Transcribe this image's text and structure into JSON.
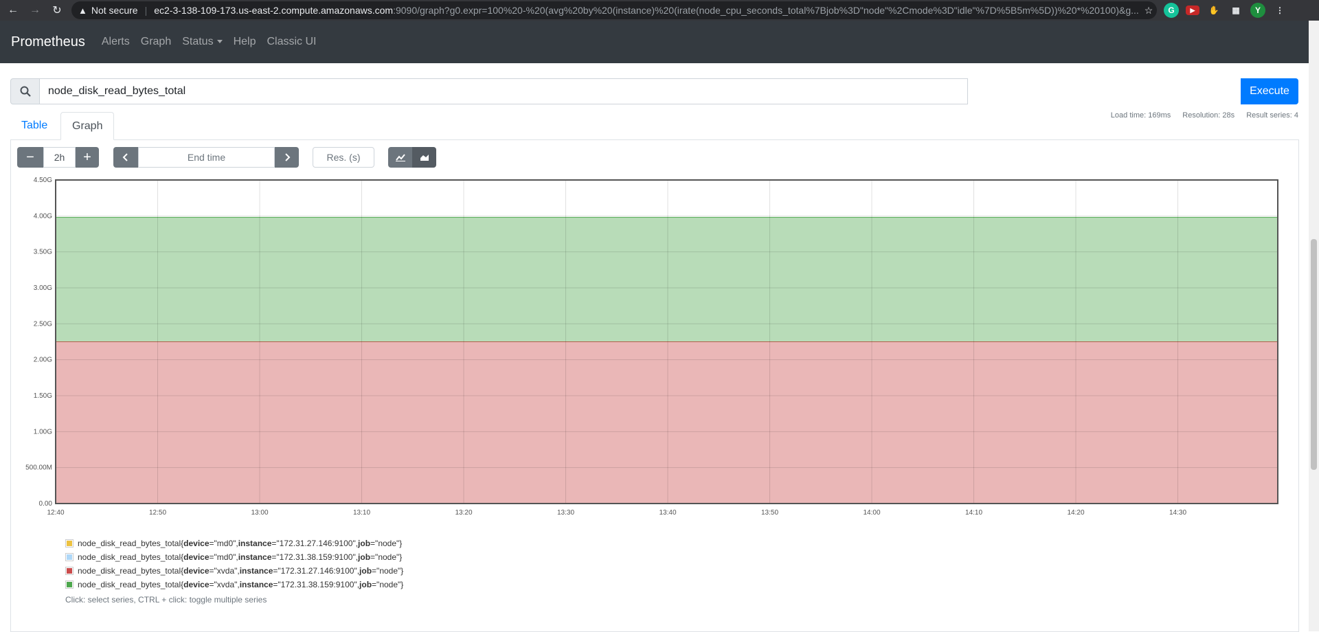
{
  "browser": {
    "security_warning": "Not secure",
    "url_host": "ec2-3-138-109-173.us-east-2.compute.amazonaws.com",
    "url_path": ":9090/graph?g0.expr=100%20-%20(avg%20by%20(instance)%20(irate(node_cpu_seconds_total%7Bjob%3D\"node\"%2Cmode%3D\"idle\"%7D%5B5m%5D))%20*%20100)&g...",
    "profile_initial": "Y"
  },
  "navbar": {
    "brand": "Prometheus",
    "links": [
      "Alerts",
      "Graph",
      "Status",
      "Help",
      "Classic UI"
    ]
  },
  "query": {
    "expression": "node_disk_read_bytes_total",
    "execute_label": "Execute"
  },
  "stats": {
    "load_time": "Load time: 169ms",
    "resolution": "Resolution: 28s",
    "result_series": "Result series: 4"
  },
  "tabs": {
    "table": "Table",
    "graph": "Graph"
  },
  "controls": {
    "range": "2h",
    "end_time_placeholder": "End time",
    "resolution_placeholder": "Res. (s)"
  },
  "chart_data": {
    "type": "area",
    "stacked": true,
    "x": [
      "12:40",
      "12:50",
      "13:00",
      "13:10",
      "13:20",
      "13:30",
      "13:40",
      "13:50",
      "14:00",
      "14:10",
      "14:20",
      "14:30"
    ],
    "y_ticks": [
      "0.00",
      "500.00M",
      "1.00G",
      "1.50G",
      "2.00G",
      "2.50G",
      "3.00G",
      "3.50G",
      "4.00G",
      "4.50G"
    ],
    "ylim": [
      0,
      4.5
    ],
    "y_unit": "G",
    "series": [
      {
        "name": "node_disk_read_bytes_total{device=\"md0\", instance=\"172.31.27.146:9100\", job=\"node\"}",
        "color": "#edc240",
        "value": 0
      },
      {
        "name": "node_disk_read_bytes_total{device=\"md0\", instance=\"172.31.38.159:9100\", job=\"node\"}",
        "color": "#afd8f8",
        "value": 0
      },
      {
        "name": "node_disk_read_bytes_total{device=\"xvda\", instance=\"172.31.27.146:9100\", job=\"node\"}",
        "color": "#cb4b4b",
        "value": 2.25
      },
      {
        "name": "node_disk_read_bytes_total{device=\"xvda\", instance=\"172.31.38.159:9100\", job=\"node\"}",
        "color": "#4da74d",
        "value": 1.73
      }
    ],
    "grid": true,
    "legend_position": "bottom-left"
  },
  "legend": [
    {
      "metric": "node_disk_read_bytes_total",
      "open": "{",
      "k1": "device",
      "v1": "=\"md0\", ",
      "k2": "instance",
      "v2": "=\"172.31.27.146:9100\", ",
      "k3": "job",
      "v3": "=\"node\"}"
    },
    {
      "metric": "node_disk_read_bytes_total",
      "open": "{",
      "k1": "device",
      "v1": "=\"md0\", ",
      "k2": "instance",
      "v2": "=\"172.31.38.159:9100\", ",
      "k3": "job",
      "v3": "=\"node\"}"
    },
    {
      "metric": "node_disk_read_bytes_total",
      "open": "{",
      "k1": "device",
      "v1": "=\"xvda\", ",
      "k2": "instance",
      "v2": "=\"172.31.27.146:9100\", ",
      "k3": "job",
      "v3": "=\"node\"}"
    },
    {
      "metric": "node_disk_read_bytes_total",
      "open": "{",
      "k1": "device",
      "v1": "=\"xvda\", ",
      "k2": "instance",
      "v2": "=\"172.31.38.159:9100\", ",
      "k3": "job",
      "v3": "=\"node\"}"
    }
  ],
  "hint": "Click: select series, CTRL + click: toggle multiple series"
}
